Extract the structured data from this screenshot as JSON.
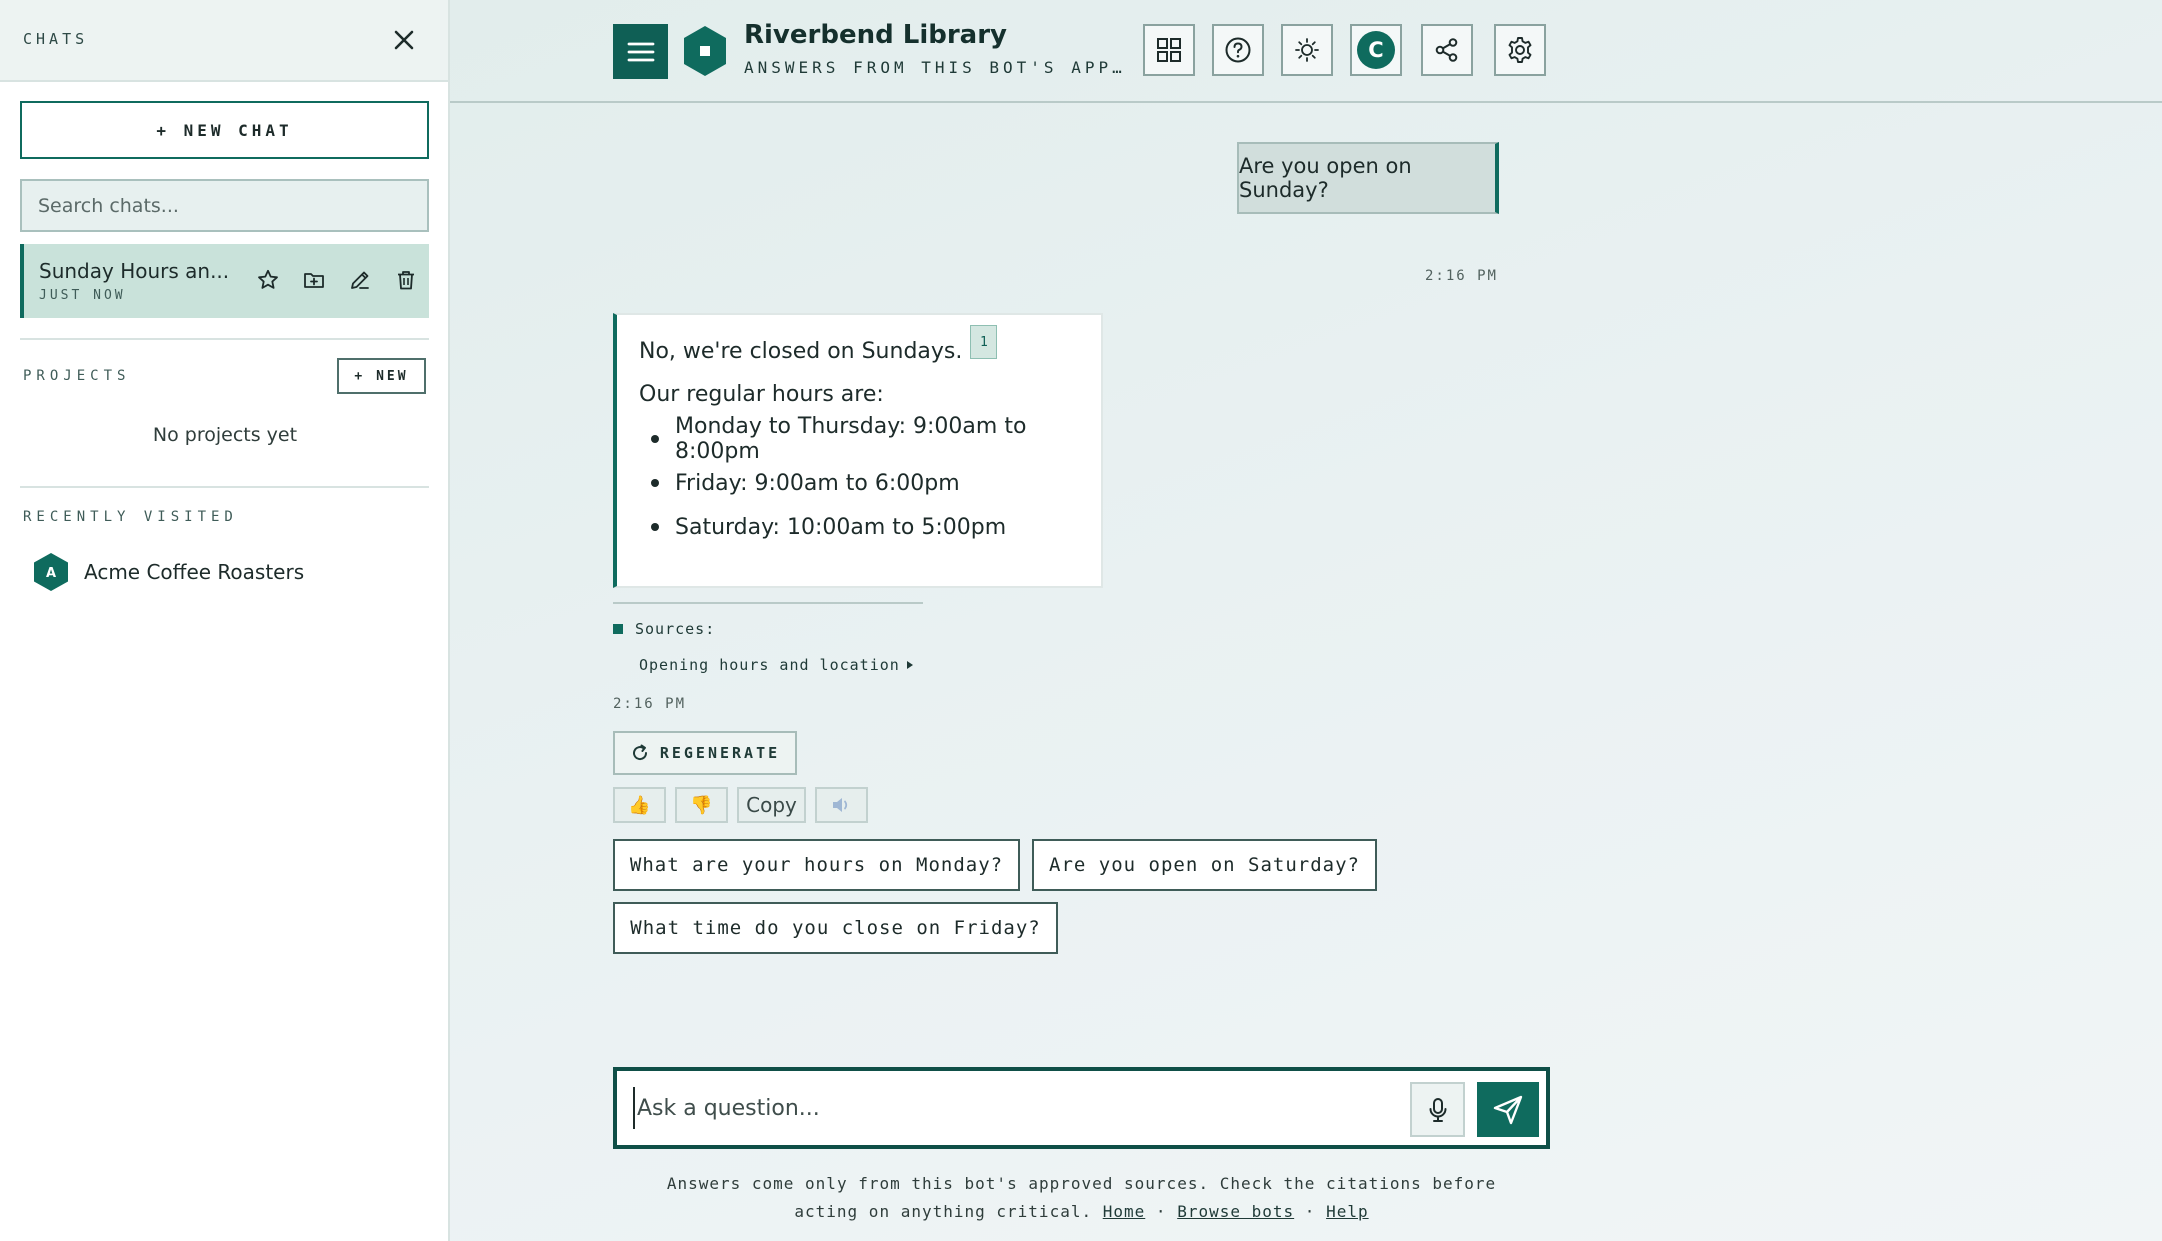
{
  "sidebar": {
    "title": "CHATS",
    "new_chat_label": "+ NEW CHAT",
    "search_placeholder": "Search chats...",
    "chat_item": {
      "title": "Sunday Hours an...",
      "time": "JUST NOW"
    },
    "projects_label": "PROJECTS",
    "new_project_label": "+ NEW",
    "no_projects_text": "No projects yet",
    "recent_label": "RECENTLY VISITED",
    "recent_items": [
      {
        "initial": "A",
        "name": "Acme Coffee Roasters"
      }
    ]
  },
  "header": {
    "bot_name": "Riverbend Library",
    "bot_subtitle": "ANSWERS FROM THIS BOT'S APPROVED SOURCES",
    "avatar_initial": "C"
  },
  "conversation": {
    "user_message": "Are you open on Sunday?",
    "user_time": "2:16 PM",
    "bot_line1": "No, we're closed on Sundays.",
    "citation_number": "1",
    "bot_line2": "Our regular hours are:",
    "bot_list": [
      "Monday to Thursday: 9:00am to 8:00pm",
      "Friday: 9:00am to 6:00pm",
      "Saturday: 10:00am to 5:00pm"
    ],
    "sources_label": "Sources:",
    "source_link": "Opening hours and location",
    "bot_time": "2:16 PM",
    "regenerate_label": "REGENERATE",
    "copy_label": "Copy",
    "suggestions": [
      "What are your hours on Monday?",
      "Are you open on Saturday?",
      "What time do you close on Friday?"
    ]
  },
  "composer": {
    "placeholder": "Ask a question..."
  },
  "footer": {
    "line1": "Answers come only from this bot's approved sources. Check the citations before",
    "line2": "acting on anything critical.",
    "links": [
      "Home",
      "Browse bots",
      "Help"
    ],
    "separator": "·"
  },
  "colors": {
    "accent": "#0f6b5e",
    "accent_dark": "#0f5f55",
    "selected_chat_bg": "#c9e2da"
  }
}
